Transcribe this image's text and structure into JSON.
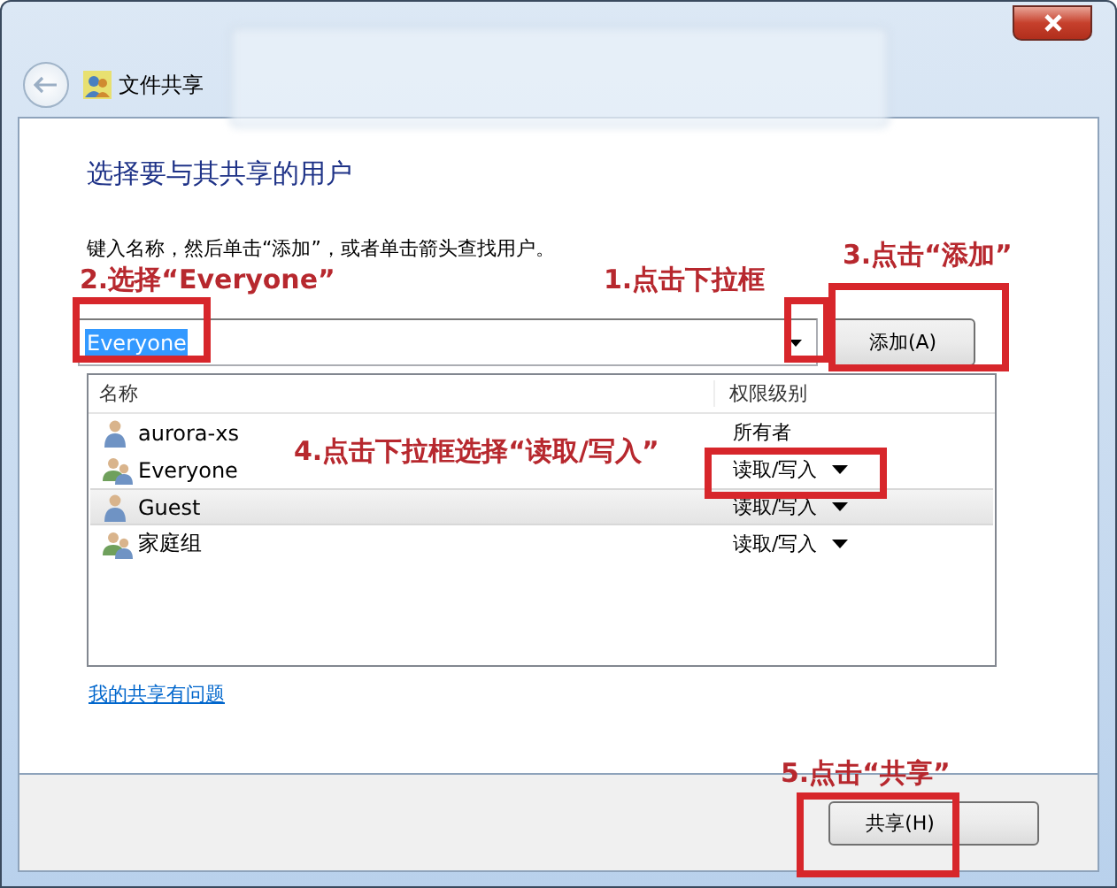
{
  "window": {
    "title": "文件共享"
  },
  "heading": "选择要与其共享的用户",
  "instruction": "键入名称，然后单击“添加”，或者单击箭头查找用户。",
  "name_field": {
    "value": "Everyone",
    "text_selected": true
  },
  "add_button": "添加(A)",
  "list": {
    "columns": [
      "名称",
      "权限级别"
    ],
    "rows": [
      {
        "name": "aurora-xs",
        "kind": "user",
        "permission": "所有者",
        "dropdown": false,
        "selected": false
      },
      {
        "name": "Everyone",
        "kind": "group",
        "permission": "读取/写入",
        "dropdown": true,
        "selected": false
      },
      {
        "name": "Guest",
        "kind": "user",
        "permission": "读取/写入",
        "dropdown": true,
        "selected": true
      },
      {
        "name": "家庭组",
        "kind": "group",
        "permission": "读取/写入",
        "dropdown": true,
        "selected": false
      }
    ]
  },
  "help_link": "我的共享有问题",
  "share_button": "共享(H)",
  "annotations": [
    "2.选择“Everyone”",
    "1.点击下拉框",
    "3.点击“添加”",
    "4.点击下拉框选择“读取/写入”",
    "5.点击“共享”"
  ]
}
